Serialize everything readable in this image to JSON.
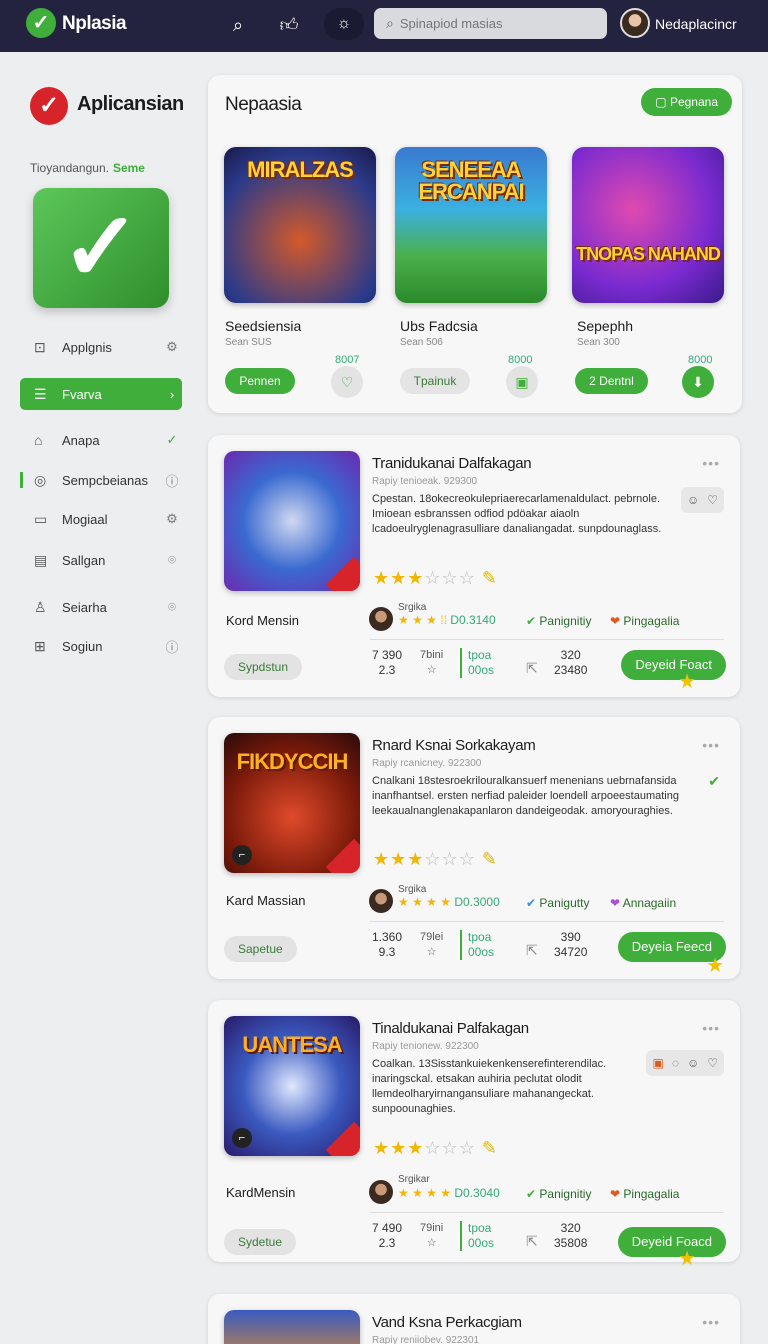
{
  "topbar": {
    "app_title": "Nplasia",
    "search_placeholder": "Spinapiod masias",
    "username": "Nedaplacincr"
  },
  "sidebar": {
    "title": "Aplicansian",
    "subtitle": "Tioyandangun.",
    "subtitle_accent": "Seme",
    "items": [
      {
        "label": "Applgnis",
        "icon": "box-icon",
        "right_icon": "gear-icon"
      },
      {
        "label": "Fvarva",
        "icon": "list-icon",
        "right_icon": "chevron-right-icon",
        "active": true
      },
      {
        "label": "Anapa",
        "icon": "home-icon",
        "right_icon": "check-icon"
      },
      {
        "label": "Sempcbeianas",
        "icon": "target-icon",
        "right_icon": "info-icon"
      },
      {
        "label": "Mogiaal",
        "icon": "tablet-icon",
        "right_icon": "gear-icon"
      },
      {
        "label": "Sallgan",
        "icon": "grid-icon",
        "right_icon": "pin-icon"
      },
      {
        "label": "Seiarha",
        "icon": "user-icon",
        "right_icon": "pin-icon"
      },
      {
        "label": "Sogiun",
        "icon": "window-icon",
        "right_icon": "info-icon"
      }
    ]
  },
  "featured": {
    "title": "Nepaasia",
    "button": "Pegnana",
    "games": [
      {
        "thumb_title": "MIRALZAS",
        "name": "Seedsiensia",
        "sub": "Sean SUS",
        "count": "8007",
        "button": "Pennen",
        "btn_style": "green",
        "icon": "heart-icon",
        "icon_style": "light"
      },
      {
        "thumb_title": "SENEEAA ERCANPAI",
        "name": "Ubs Fadcsia",
        "sub": "Sean 506",
        "count": "8000",
        "button": "Tpainuk",
        "btn_style": "gray",
        "icon": "box-icon",
        "icon_style": "light"
      },
      {
        "thumb_title": "TNOPAS NAHAND",
        "name": "Sepephh",
        "sub": "Sean 300",
        "count": "8000",
        "button": "2 Dentnl",
        "btn_style": "green",
        "icon": "download-icon",
        "icon_style": "green"
      }
    ]
  },
  "list": [
    {
      "thumb_title": "",
      "title": "Tranidukanai Dalfakagan",
      "meta": "Rapiy tenioeak. 929300",
      "desc": "Cpestan. 18okecreokulepriaerecarlamenaldulact. pebrnole. Imioean esbranssen odfiod pdöakar aiaoln lcadoeulryglenagrasulliare danaliangadat. sunpdounaglass.",
      "sub": "Kord Mensin",
      "user_label": "Srgika",
      "user_value": "D0.3140",
      "tag1": "Panignitiy",
      "tag2": "Pingagalia",
      "pill": "Sypdstun",
      "n1a": "7 390",
      "n1b": "2.3",
      "n2": "7bini",
      "n3a": "tpoa",
      "n3b": "00os",
      "n5a": "320",
      "n5b": "23480",
      "download": "Deyeid Foact",
      "actions": [
        "☺",
        "♡"
      ]
    },
    {
      "thumb_title": "FIKDYCCIH",
      "title": "Rnard Ksnai Sorkakayam",
      "meta": "Rapiy rcanicney. 922300",
      "desc": "Cnalkani 18stesroekrilouralkansuerf menenians uebrnafansida inanfhantsel. ersten nerfiad paleider loendell arpoeestaumating leekaualnanglenakapanlaron dandeigeodak. amoryouraghies.",
      "sub": "Kard Massian",
      "user_label": "Srgika",
      "user_value": "D0.3000",
      "tag1": "Panigutty",
      "tag2": "Annagaiin",
      "pill": "Sapetue",
      "n1a": "1.360",
      "n1b": "9.3",
      "n2": "79lei",
      "n3a": "tpoa",
      "n3b": "00os",
      "n5a": "390",
      "n5b": "34720",
      "download": "Deyeia Feecd",
      "actions": []
    },
    {
      "thumb_title": "UANTESA",
      "title": "Tinaldukanai Palfakagan",
      "meta": "Rapiy tenionew. 922300",
      "desc": "Coalkan. 13Sisstankuiekenkenserefinterendilac. inaringsckal. etsakan auhiria peclutat olodit llemdeolharyirnangansuliare mahanangeckat. sunpoounaghies.",
      "sub": "KardMensin",
      "user_label": "Srgikar",
      "user_value": "D0.3040",
      "tag1": "Panignitiy",
      "tag2": "Pingagalia",
      "pill": "Sydetue",
      "n1a": "7 490",
      "n1b": "2.3",
      "n2": "79ini",
      "n3a": "tpoa",
      "n3b": "00os",
      "n5a": "320",
      "n5b": "35808",
      "download": "Deyeid Foacd",
      "actions": [
        "▣",
        "◌",
        "☺",
        "♡"
      ]
    }
  ],
  "peek": {
    "title": "Vand Ksna Perkacgiam",
    "meta": "Rapiy reniiobev. 922301"
  }
}
